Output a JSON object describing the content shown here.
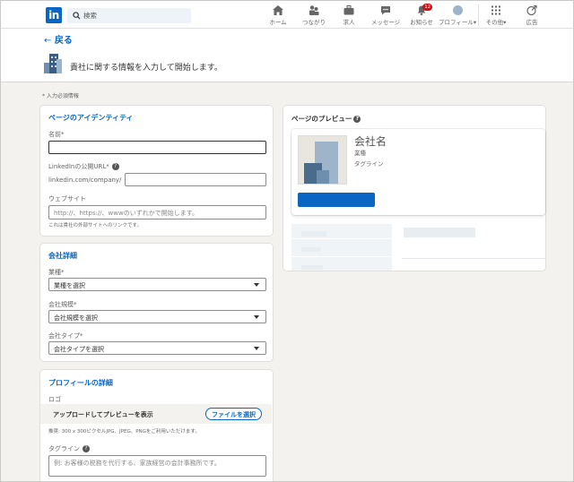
{
  "nav": {
    "logo_text": "in",
    "search_placeholder": "検索",
    "items": [
      {
        "label": "ホーム",
        "icon": "home-icon"
      },
      {
        "label": "つながり",
        "icon": "people-icon"
      },
      {
        "label": "求人",
        "icon": "briefcase-icon"
      },
      {
        "label": "メッセージ",
        "icon": "message-icon"
      },
      {
        "label": "お知らせ",
        "icon": "bell-icon",
        "badge": "12"
      },
      {
        "label": "プロフィール",
        "icon": "avatar-icon"
      },
      {
        "label": "その他",
        "icon": "grid-icon"
      },
      {
        "label": "広告",
        "icon": "compass-icon"
      }
    ]
  },
  "header": {
    "back_label": "戻る",
    "intro_text": "貴社に関する情報を入力して開始します。"
  },
  "required_note": "* 入力必須情報",
  "identity": {
    "title": "ページのアイデンティティ",
    "name_label": "名前*",
    "name_value": "",
    "url_label": "LinkedInの公開URL*",
    "url_prefix": "linkedin.com/company/",
    "url_value": "",
    "website_label": "ウェブサイト",
    "website_placeholder": "http://、https://、wwwのいずれかで開始します。",
    "website_helper": "これは貴社の外部サイトへのリンクです。"
  },
  "company": {
    "title": "会社詳細",
    "industry_label": "業種*",
    "industry_value": "業種を選択",
    "size_label": "会社規模*",
    "size_value": "会社規模を選択",
    "type_label": "会社タイプ*",
    "type_value": "会社タイプを選択"
  },
  "profile": {
    "title": "プロフィールの詳細",
    "logo_label": "ロゴ",
    "upload_text": "アップロードしてプレビューを表示",
    "upload_button": "ファイルを選択",
    "upload_helper": "推奨: 300 x 300ピクセルJPG、JPEG、PNGをご利用いただけます。",
    "tagline_label": "タグライン",
    "tagline_placeholder": "例: お客様の税務を代行する、家族経営の会計事務所です。"
  },
  "preview": {
    "title": "ページのプレビュー",
    "company_name": "会社名",
    "industry": "業種",
    "tagline": "タグライン"
  },
  "colors": {
    "brand": "#0a66c2",
    "background": "#f3f2ef",
    "badge": "#cc1016"
  }
}
